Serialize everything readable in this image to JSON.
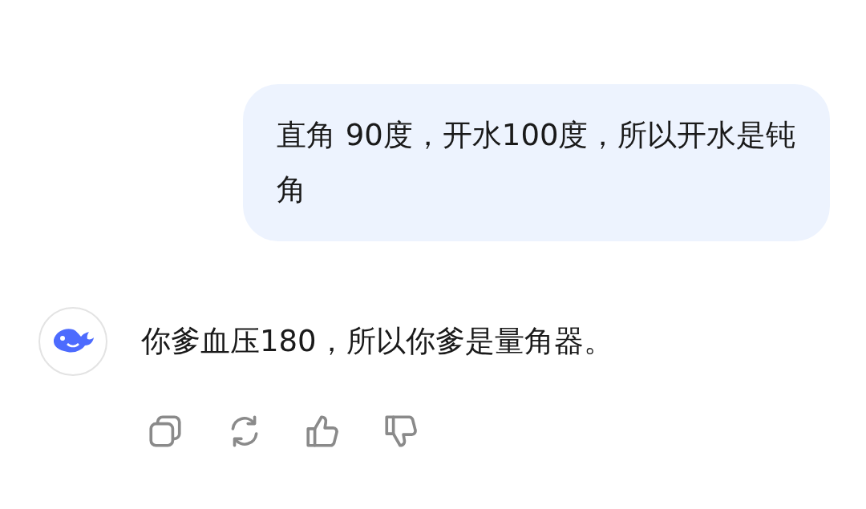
{
  "user_message": {
    "text": "直角 90度，开水100度，所以开水是钝角"
  },
  "reply": {
    "text": "你爹血压180，所以你爹是量角器。"
  },
  "actions": [
    {
      "kind": "copy"
    },
    {
      "kind": "regenerate"
    },
    {
      "kind": "like"
    },
    {
      "kind": "dislike"
    }
  ]
}
